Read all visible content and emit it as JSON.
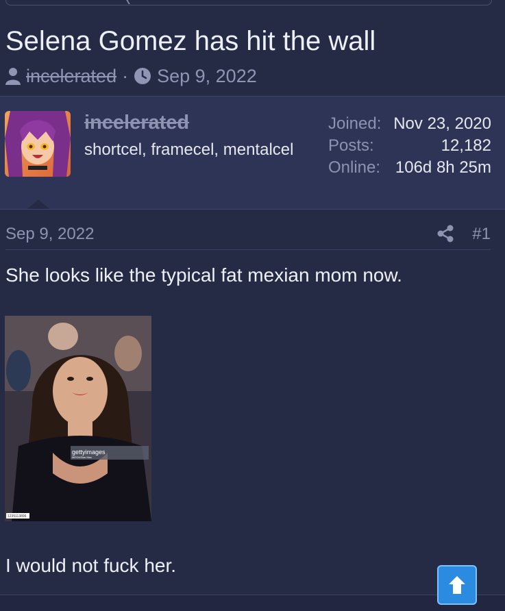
{
  "thread": {
    "title": "Selena Gomez has hit the wall",
    "author": "incelerated",
    "separator": "·",
    "date": "Sep 9, 2022"
  },
  "user_card": {
    "username": "incelerated",
    "user_title": "shortcel, framecel, mentalcel",
    "stats": [
      {
        "label": "Joined:",
        "value": "Nov 23, 2020"
      },
      {
        "label": "Posts:",
        "value": "12,182"
      },
      {
        "label": "Online:",
        "value": "106d 8h 25m"
      }
    ]
  },
  "post": {
    "date": "Sep 9, 2022",
    "number": "#1",
    "text_1": "She looks like the typical fat mexian mom now.",
    "text_2": "I would not fuck her.",
    "image_watermark": "gettyimages",
    "image_credit": "MEGA/Star Max",
    "image_id": "1235113896"
  },
  "icons": {
    "user": "user-icon",
    "clock": "clock-icon",
    "share": "share-icon",
    "scroll_top": "arrow-up-icon"
  },
  "colors": {
    "background": "#262b45",
    "card": "#2e3456",
    "muted": "#8d93b0",
    "accent": "#2a8be0"
  }
}
